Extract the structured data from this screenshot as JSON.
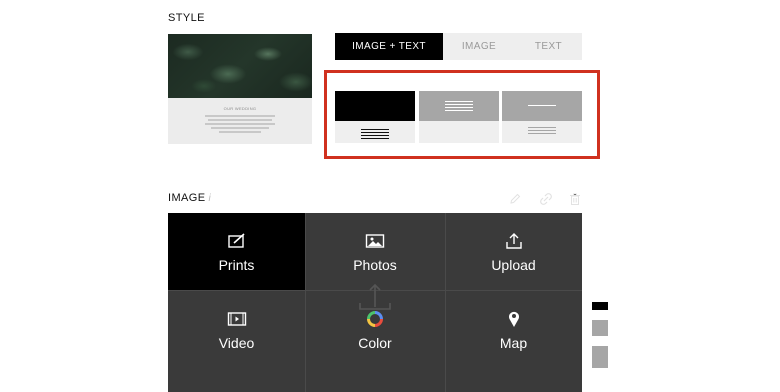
{
  "style_section": {
    "title": "STYLE",
    "preview": {
      "caption": "OUR WEDDING"
    },
    "tabs": [
      {
        "label": "IMAGE + TEXT",
        "active": true
      },
      {
        "label": "IMAGE",
        "active": false
      },
      {
        "label": "TEXT",
        "active": false
      }
    ],
    "layout_options": [
      {
        "name": "black-block-text-below",
        "selected": true
      },
      {
        "name": "gray-block-text-overlay"
      },
      {
        "name": "gray-block-title-overlay"
      }
    ],
    "highlight_color": "#d0311f"
  },
  "image_section": {
    "title": "IMAGE",
    "hint": "i",
    "toolbar_icons": [
      "pencil-icon",
      "link-icon",
      "trash-icon"
    ],
    "options": [
      {
        "label": "Prints",
        "icon": "prints-icon",
        "active": true
      },
      {
        "label": "Photos",
        "icon": "photos-icon"
      },
      {
        "label": "Upload",
        "icon": "upload-icon"
      },
      {
        "label": "Video",
        "icon": "video-icon"
      },
      {
        "label": "Color",
        "icon": "color-wheel-icon"
      },
      {
        "label": "Map",
        "icon": "map-pin-icon"
      }
    ]
  },
  "colors": {
    "tile_bg": "#3a3a3a",
    "active_tile": "#000000",
    "swatches": [
      "#000000",
      "#a6a6a6",
      "#a6a6a6"
    ]
  }
}
